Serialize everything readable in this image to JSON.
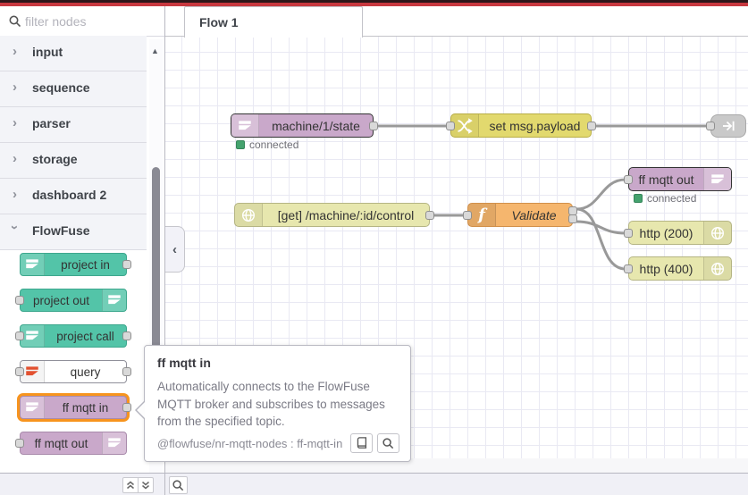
{
  "palette": {
    "search_placeholder": "filter nodes",
    "categories": [
      {
        "label": "input"
      },
      {
        "label": "sequence"
      },
      {
        "label": "parser"
      },
      {
        "label": "storage"
      },
      {
        "label": "dashboard 2"
      },
      {
        "label": "FlowFuse"
      }
    ],
    "nodes": [
      {
        "label": "project in"
      },
      {
        "label": "project out"
      },
      {
        "label": "project call"
      },
      {
        "label": "query"
      },
      {
        "label": "ff mqtt in"
      },
      {
        "label": "ff mqtt out"
      }
    ]
  },
  "tooltip": {
    "title": "ff mqtt in",
    "description": "Automatically connects to the FlowFuse MQTT broker and subscribes to messages from the specified topic.",
    "module": "@flowfuse/nr-mqtt-nodes : ff-mqtt-in"
  },
  "workspace": {
    "tab_label": "Flow 1",
    "nodes": {
      "mqtt_in": {
        "label": "machine/1/state",
        "status": "connected"
      },
      "change": {
        "label": "set msg.payload"
      },
      "http_in": {
        "label": "[get] /machine/:id/control"
      },
      "function": {
        "label": "Validate"
      },
      "mqtt_out": {
        "label": "ff mqtt out",
        "status": "connected"
      },
      "http_200": {
        "label": "http (200)"
      },
      "http_400": {
        "label": "http (400)"
      }
    }
  },
  "icons": {
    "chevron_right": "›",
    "chevron_down": "›",
    "collapse_left": "‹",
    "triangle_up": "▲",
    "function_glyph": "f"
  },
  "colors": {
    "header_red": "#c7383f",
    "teal": "#53c4a8",
    "mauve": "#c9a8ca",
    "change_yellow": "#e2d96e",
    "http_yellow": "#e7e7ae",
    "function_orange": "#f5b66e",
    "link_gray": "#c9c9c9",
    "status_green": "#44a26e",
    "hover_orange": "#f7941e"
  }
}
